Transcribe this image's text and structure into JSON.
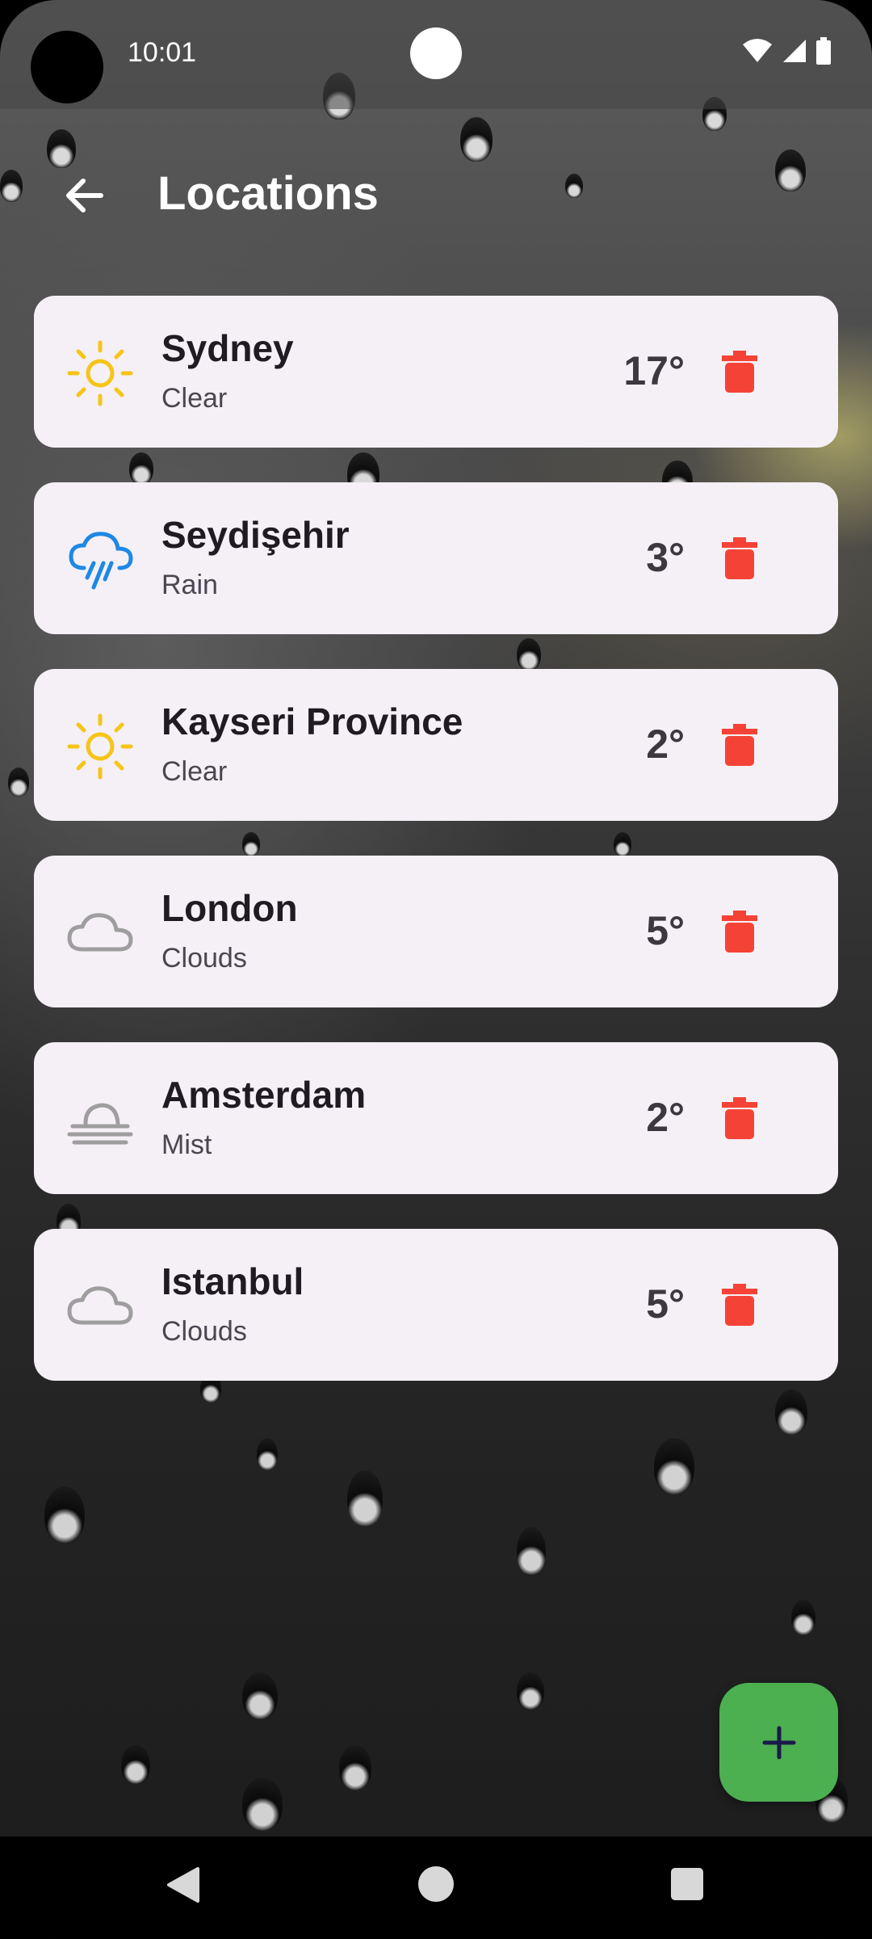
{
  "status_bar": {
    "time": "10:01"
  },
  "app_bar": {
    "title": "Locations"
  },
  "locations": [
    {
      "city": "Sydney",
      "condition": "Clear",
      "temp": "17°",
      "icon": "sun-icon"
    },
    {
      "city": "Seydişehir",
      "condition": "Rain",
      "temp": "3°",
      "icon": "rain-icon"
    },
    {
      "city": "Kayseri Province",
      "condition": "Clear",
      "temp": "2°",
      "icon": "sun-icon"
    },
    {
      "city": "London",
      "condition": "Clouds",
      "temp": "5°",
      "icon": "cloud-icon"
    },
    {
      "city": "Amsterdam",
      "condition": "Mist",
      "temp": "2°",
      "icon": "mist-icon"
    },
    {
      "city": "Istanbul",
      "condition": "Clouds",
      "temp": "5°",
      "icon": "cloud-icon"
    }
  ],
  "colors": {
    "card_bg": "#f5f0f6",
    "delete": "#f44336",
    "fab": "#4caf50",
    "sun": "#f5c518",
    "rain": "#1e88e5",
    "cloud": "#9e9e9e"
  }
}
